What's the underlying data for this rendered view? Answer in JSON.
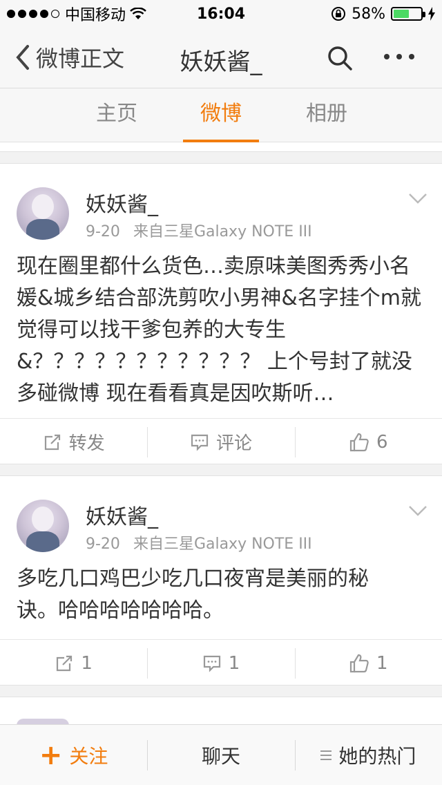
{
  "status_bar": {
    "carrier": "中国移动",
    "time": "16:04",
    "battery": "58%",
    "battery_level": 0.58,
    "signal_bars_filled": 4,
    "signal_bars_total": 5
  },
  "nav": {
    "back_label": "微博正文",
    "title": "妖妖酱_"
  },
  "tabs": [
    {
      "label": "主页"
    },
    {
      "label": "微博",
      "active": true
    },
    {
      "label": "相册"
    }
  ],
  "posts": [
    {
      "username": "妖妖酱_",
      "date": "9-20",
      "source": "来自三星Galaxy NOTE III",
      "text": "现在圈里都什么货色…卖原味美图秀秀小名媛&城乡结合部洗剪吹小男神&名字挂个m就觉得可以找干爹包养的大专生&？？？？？？？？？？？ 上个号封了就没多碰微博 现在看看真是因吹斯听…",
      "repost_label": "转发",
      "comment_label": "评论",
      "like_count": "6"
    },
    {
      "username": "妖妖酱_",
      "date": "9-20",
      "source": "来自三星Galaxy NOTE III",
      "text": "多吃几口鸡巴少吃几口夜宵是美丽的秘诀。哈哈哈哈哈哈哈。",
      "repost_count": "1",
      "comment_count": "1",
      "like_count": "1"
    }
  ],
  "bottom_bar": {
    "follow_label": "关注",
    "chat_label": "聊天",
    "hot_label": "她的热门"
  },
  "colors": {
    "accent": "#f27d0f",
    "battery": "#4cd964"
  },
  "icons": [
    "wifi-icon",
    "lock-rotation-icon",
    "battery-icon",
    "charging-icon",
    "back-chevron-icon",
    "search-icon",
    "more-icon",
    "chevron-down-icon",
    "repost-icon",
    "comment-icon",
    "like-icon",
    "plus-icon",
    "menu-icon"
  ]
}
